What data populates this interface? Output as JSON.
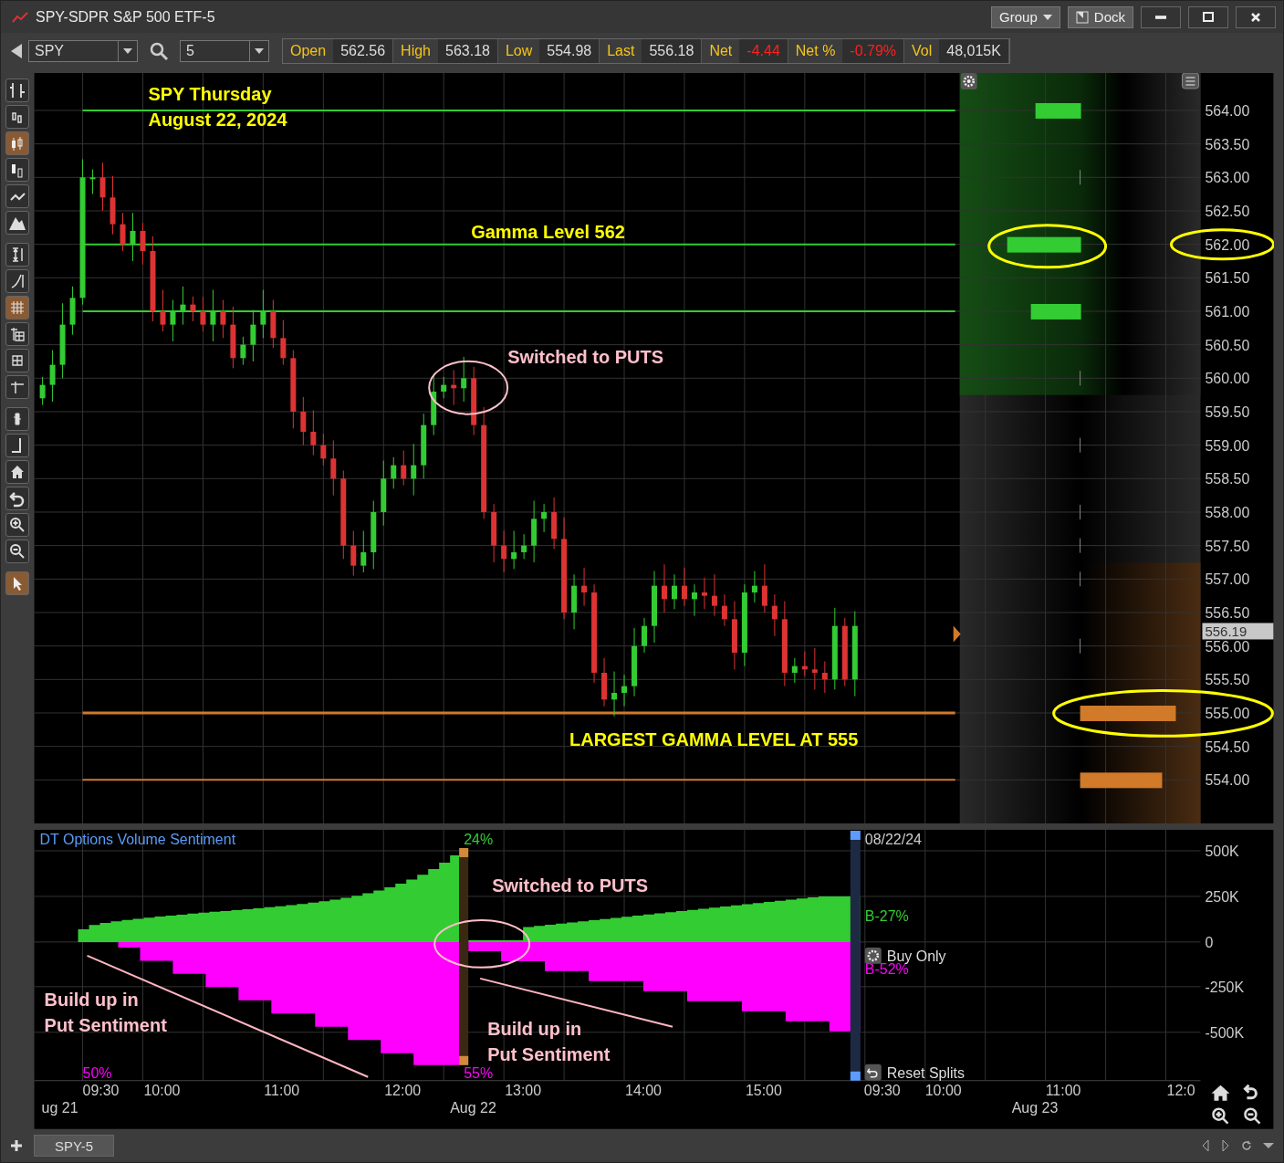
{
  "window": {
    "title": "SPY-SDPR S&P 500 ETF-5",
    "buttons": [
      {
        "label": "Group",
        "kind": "dropdown"
      },
      {
        "label": "Dock",
        "kind": "dock"
      }
    ]
  },
  "toolbar": {
    "symbol": "SPY",
    "interval": "5",
    "quotes": [
      {
        "label": "Open",
        "value": "562.56",
        "negative": false
      },
      {
        "label": "High",
        "value": "563.18",
        "negative": false
      },
      {
        "label": "Low",
        "value": "554.98",
        "negative": false
      },
      {
        "label": "Last",
        "value": "556.18",
        "negative": false
      },
      {
        "label": "Net",
        "value": "-4.44",
        "negative": true
      },
      {
        "label": "Net %",
        "value": "-0.79%",
        "negative": true
      },
      {
        "label": "Vol",
        "value": "48,015K",
        "negative": false
      }
    ]
  },
  "tools": [
    {
      "selected": false
    },
    {
      "selected": false
    },
    {
      "selected": true
    },
    {
      "selected": false
    },
    {
      "selected": false
    },
    {
      "selected": false
    },
    {
      "selected": false
    },
    {
      "selected": false
    },
    {
      "selected": true
    },
    {
      "selected": false
    },
    {
      "selected": false
    },
    {
      "selected": false
    },
    {
      "selected": false
    },
    {
      "selected": false
    },
    {
      "selected": false
    },
    {
      "selected": false
    },
    {
      "selected": false
    },
    {
      "selected": false
    },
    {
      "selected": true
    }
  ],
  "price_chart": {
    "annotations": [
      "SPY Thursday",
      "August 22, 2024",
      "Gamma Level 562",
      "Switched to PUTS",
      "LARGEST GAMMA LEVEL AT 555"
    ],
    "price_axis": [
      "564.00",
      "563.50",
      "563.00",
      "562.50",
      "562.00",
      "561.50",
      "561.00",
      "560.50",
      "560.00",
      "559.50",
      "559.00",
      "558.50",
      "558.00",
      "557.50",
      "557.00",
      "556.50",
      "556.00",
      "555.50",
      "555.00",
      "554.50",
      "554.00"
    ],
    "last_price": "556.19"
  },
  "sentiment_pane": {
    "title": "DT Options Volume Sentiment",
    "labels": [
      "24%",
      "55%",
      "50%",
      "08/22/24",
      "B-27%",
      "B-52%"
    ],
    "annotations": [
      "Switched to PUTS",
      "Build up in",
      "Put Sentiment",
      "Build up in",
      "Put Sentiment"
    ],
    "buttons": [
      "Buy Only",
      "Reset Splits"
    ],
    "axis": [
      "500K",
      "250K",
      "0",
      "-250K",
      "-500K"
    ]
  },
  "time_axis": {
    "times": [
      "09:30",
      "10:00",
      "11:00",
      "12:00",
      "13:00",
      "14:00",
      "15:00",
      "09:30",
      "10:00",
      "11:00",
      "12:0"
    ],
    "dates": [
      "ug 21",
      "Aug 22",
      "Aug 23"
    ]
  },
  "bottom_bar": {
    "tabs": [
      {
        "label": "SPY-5",
        "selected": true
      }
    ]
  }
}
